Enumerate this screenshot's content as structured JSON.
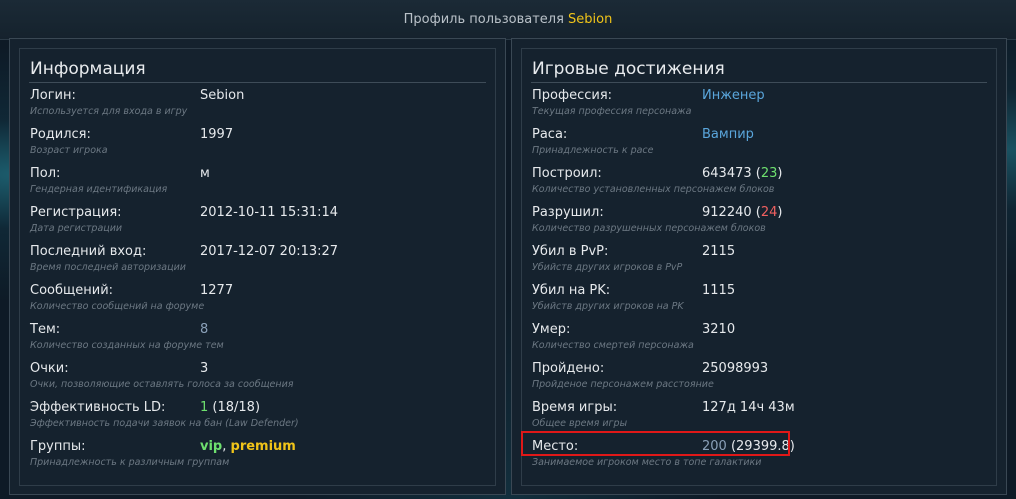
{
  "header": {
    "title_prefix": "Профиль пользователя",
    "username": "Sebion"
  },
  "info": {
    "title": "Информация",
    "rows": [
      {
        "label": "Логин:",
        "hint": "Используется для входа в игру",
        "value": "Sebion"
      },
      {
        "label": "Родился:",
        "hint": "Возраст игрока",
        "value": "1997"
      },
      {
        "label": "Пол:",
        "hint": "Гендерная идентификация",
        "value": "м"
      },
      {
        "label": "Регистрация:",
        "hint": "Дата регистрации",
        "value": "2012-10-11 15:31:14"
      },
      {
        "label": "Последний вход:",
        "hint": "Время последней авторизации",
        "value": "2017-12-07 20:13:27"
      },
      {
        "label": "Сообщений:",
        "hint": "Количество сообщений на форуме",
        "value": "1277"
      },
      {
        "label": "Тем:",
        "hint": "Количество созданных на форуме тем",
        "value": "8"
      },
      {
        "label": "Очки:",
        "hint": "Очки, позволяющие оставлять голоса за сообщения",
        "value": "3"
      },
      {
        "label": "Эффективность LD:",
        "hint": "Эффективность подачи заявок на бан (Law Defender)",
        "value_main": "1",
        "value_extra": " (18/18)"
      },
      {
        "label": "Группы:",
        "hint": "Принадлежность к различным группам",
        "group1": "vip",
        "sep": ", ",
        "group2": "premium"
      }
    ]
  },
  "achievements": {
    "title": "Игровые достижения",
    "rows": [
      {
        "label": "Профессия:",
        "hint": "Текущая профессия персонажа",
        "value": "Инженер"
      },
      {
        "label": "Раса:",
        "hint": "Принадлежность к расе",
        "value": "Вампир"
      },
      {
        "label": "Построил:",
        "hint": "Количество установленных персонажем блоков",
        "value_main": "643473 (",
        "value_num": "23",
        "value_end": ")"
      },
      {
        "label": "Разрушил:",
        "hint": "Количество разрушенных персонажем блоков",
        "value_main": "912240 (",
        "value_num": "24",
        "value_end": ")"
      },
      {
        "label": "Убил в PvP:",
        "hint": "Убийств других игроков в PvP",
        "value": "2115"
      },
      {
        "label": "Убил на PK:",
        "hint": "Убийств других игроков на PK",
        "value": "1115"
      },
      {
        "label": "Умер:",
        "hint": "Количество смертей персонажа",
        "value": "3210"
      },
      {
        "label": "Пройдено:",
        "hint": "Пройденое персонажем расстояние",
        "value": "25098993"
      },
      {
        "label": "Время игры:",
        "hint": "Общее время игры",
        "value": "127д 14ч 43м"
      },
      {
        "label": "Место:",
        "hint": "Занимаемое игроком место в топе галактики",
        "value_rank": "200",
        "value_extra": " (29399.8)"
      }
    ]
  },
  "colors": {
    "accent_username": "#f0c419",
    "link_blue": "#5aa6dc",
    "positive_green": "#6ee06e",
    "negative_red": "#f06060",
    "highlight_red": "#e01818"
  }
}
